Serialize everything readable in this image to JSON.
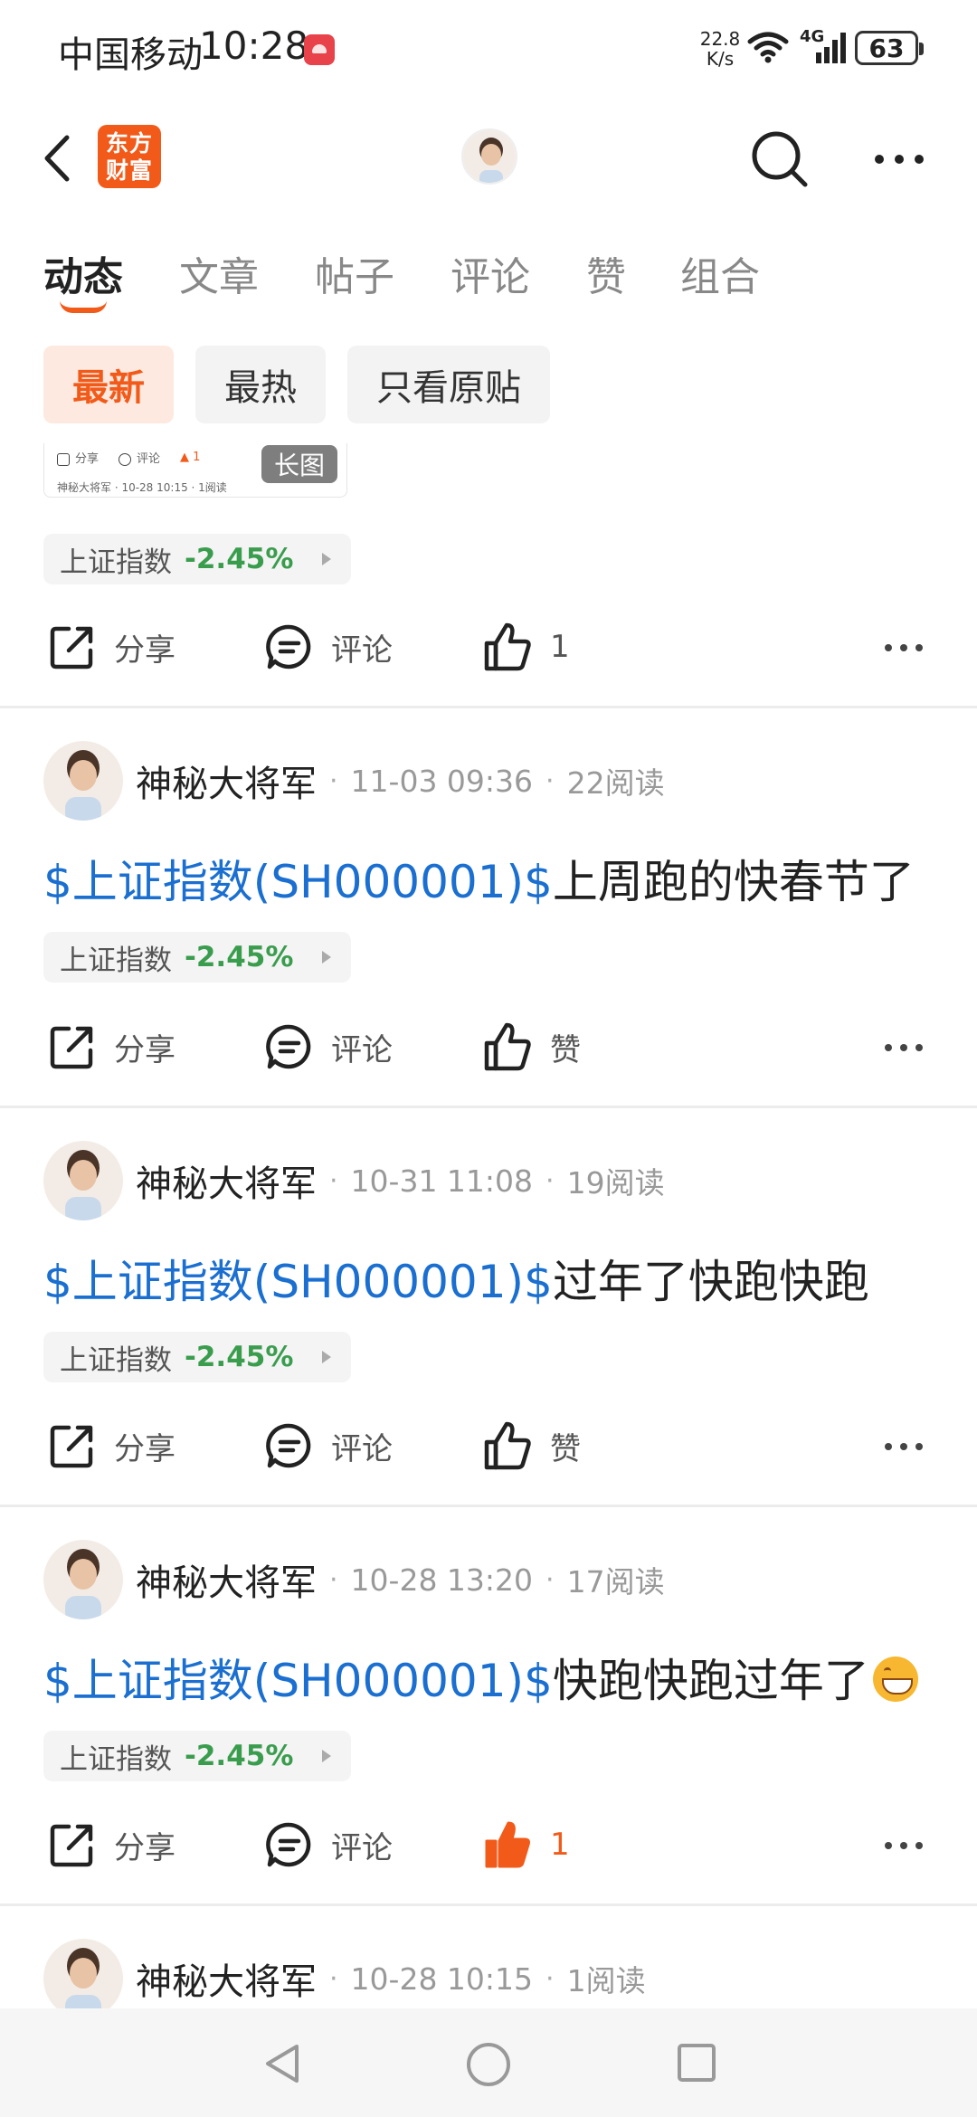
{
  "status_bar": {
    "carrier": "中国移动",
    "time": "10:28",
    "speed_value": "22.8",
    "speed_unit": "K/s",
    "network": "4G",
    "battery": "63"
  },
  "header": {
    "logo_line1": "东方",
    "logo_line2": "财富"
  },
  "tabs": [
    "动态",
    "文章",
    "帖子",
    "评论",
    "赞",
    "组合"
  ],
  "filters": [
    "最新",
    "最热",
    "只看原贴"
  ],
  "long_image": {
    "badge": "长图",
    "share": "分享",
    "comment": "评论",
    "like": "1",
    "sub": "神秘大将军 · 10-28 10:15 · 1阅读"
  },
  "stock": {
    "name": "上证指数",
    "change": "-2.45%"
  },
  "actions": {
    "share": "分享",
    "comment": "评论",
    "like": "赞"
  },
  "top_post": {
    "like_count": "1"
  },
  "posts": [
    {
      "author": "神秘大将军",
      "time": "11-03 09:36",
      "reads": "22阅读",
      "tag": "$上证指数(SH000001)$",
      "text": "上周跑的快春节了",
      "like_label": "赞",
      "liked": false
    },
    {
      "author": "神秘大将军",
      "time": "10-31 11:08",
      "reads": "19阅读",
      "tag": "$上证指数(SH000001)$",
      "text": "过年了快跑快跑",
      "like_label": "赞",
      "liked": false
    },
    {
      "author": "神秘大将军",
      "time": "10-28 13:20",
      "reads": "17阅读",
      "tag": "$上证指数(SH000001)$",
      "text": "快跑快跑过年了",
      "like_label": "1",
      "liked": true
    },
    {
      "author": "神秘大将军",
      "time": "10-28 10:15",
      "reads": "1阅读"
    }
  ],
  "colors": {
    "accent": "#f25a1a",
    "tag_blue": "#1a6fd0",
    "down_green": "#3a9d4e"
  }
}
